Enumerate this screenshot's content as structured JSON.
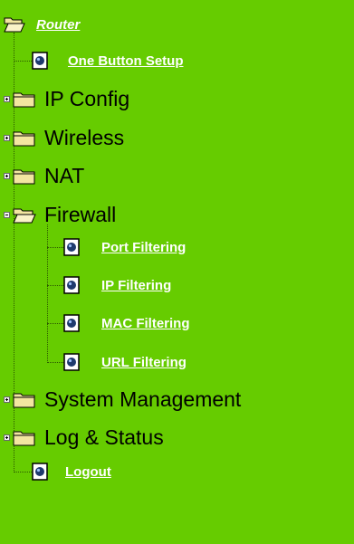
{
  "tree": {
    "root": {
      "label": "Router",
      "icon": "folder-open-icon"
    },
    "items": [
      {
        "label": "One Button Setup",
        "icon": "page-icon",
        "type": "link"
      },
      {
        "label": "IP Config",
        "icon": "folder-closed-icon",
        "type": "folder",
        "expanded": false
      },
      {
        "label": "Wireless",
        "icon": "folder-closed-icon",
        "type": "folder",
        "expanded": false
      },
      {
        "label": "NAT",
        "icon": "folder-closed-icon",
        "type": "folder",
        "expanded": false
      },
      {
        "label": "Firewall",
        "icon": "folder-open-icon",
        "type": "folder",
        "expanded": true,
        "children": [
          {
            "label": "Port Filtering",
            "icon": "page-icon"
          },
          {
            "label": "IP Filtering",
            "icon": "page-icon"
          },
          {
            "label": "MAC Filtering",
            "icon": "page-icon"
          },
          {
            "label": "URL Filtering",
            "icon": "page-icon"
          }
        ]
      },
      {
        "label": "System Management",
        "icon": "folder-closed-icon",
        "type": "folder",
        "expanded": false
      },
      {
        "label": "Log & Status",
        "icon": "folder-closed-icon",
        "type": "folder",
        "expanded": false
      },
      {
        "label": "Logout",
        "icon": "page-icon",
        "type": "link"
      }
    ]
  },
  "colors": {
    "background": "#66cc00",
    "link": "#ffffff",
    "text": "#000000",
    "folder": "#f2e6a0"
  }
}
